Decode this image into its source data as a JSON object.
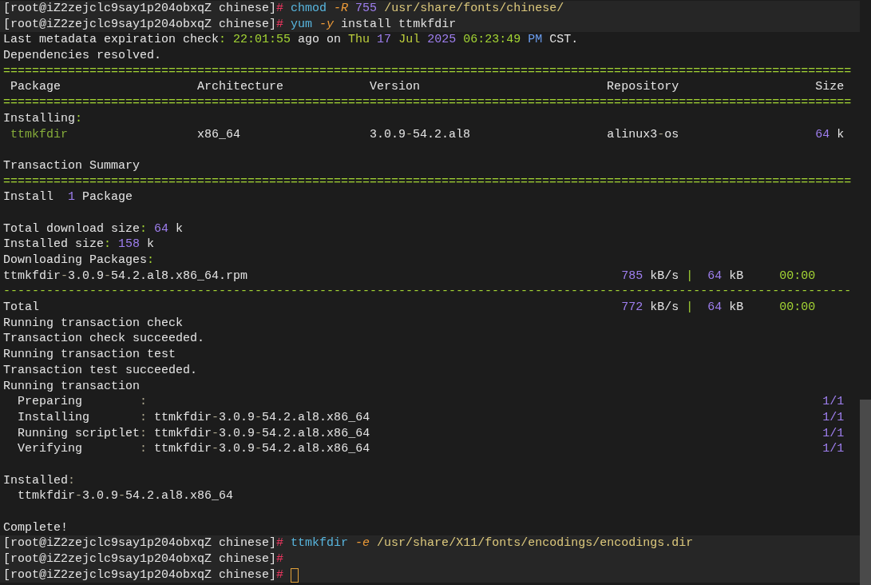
{
  "terminal": {
    "lines": [
      {
        "kind": "prompt",
        "segments": [
          {
            "text": "[root@iZ2zejclc9say1p204obxqZ chinese]",
            "kind": "text"
          },
          {
            "text": "#",
            "kind": "prompt_sign"
          },
          {
            "text": " chmod",
            "kind": "command"
          },
          {
            "text": " -R",
            "kind": "flag"
          },
          {
            "text": " 755",
            "kind": "number"
          },
          {
            "text": " /usr/share/fonts/chinese/",
            "kind": "path"
          }
        ]
      },
      {
        "kind": "prompt",
        "segments": [
          {
            "text": "[root@iZ2zejclc9say1p204obxqZ chinese]",
            "kind": "text"
          },
          {
            "text": "#",
            "kind": "prompt_sign"
          },
          {
            "text": " yum",
            "kind": "command"
          },
          {
            "text": " -y",
            "kind": "flag"
          },
          {
            "text": " install ttmkfdir",
            "kind": "text"
          }
        ]
      },
      {
        "kind": "output",
        "segments": [
          {
            "text": "Last metadata expiration check",
            "kind": "text"
          },
          {
            "text": ":",
            "kind": "accent"
          },
          {
            "text": " 22:01:55",
            "kind": "accent"
          },
          {
            "text": " ago on",
            "kind": "text"
          },
          {
            "text": " Thu",
            "kind": "date"
          },
          {
            "text": " 17",
            "kind": "number"
          },
          {
            "text": " Jul",
            "kind": "date"
          },
          {
            "text": " 2025",
            "kind": "number"
          },
          {
            "text": " 06:23:49",
            "kind": "accent"
          },
          {
            "text": " PM",
            "kind": "meridiem"
          },
          {
            "text": " CST.",
            "kind": "text"
          }
        ]
      },
      {
        "kind": "output",
        "segments": [
          {
            "text": "Dependencies resolved.",
            "kind": "text"
          }
        ]
      },
      {
        "kind": "separator",
        "segments": [
          {
            "text": "======================================================================================================================",
            "kind": "accent"
          }
        ]
      },
      {
        "kind": "header",
        "segments": [
          {
            "text": " Package                   Architecture            Version                          Repository                   Size",
            "kind": "text"
          }
        ]
      },
      {
        "kind": "separator",
        "segments": [
          {
            "text": "======================================================================================================================",
            "kind": "accent"
          }
        ]
      },
      {
        "kind": "output",
        "segments": [
          {
            "text": "Installing",
            "kind": "text"
          },
          {
            "text": ":",
            "kind": "accent"
          }
        ]
      },
      {
        "kind": "output",
        "segments": [
          {
            "text": " ttmkfdir",
            "kind": "package"
          },
          {
            "text": "                  x86_64                  3.0.9",
            "kind": "text"
          },
          {
            "text": "-",
            "kind": "punct"
          },
          {
            "text": "54.2.al8                   alinux3",
            "kind": "text"
          },
          {
            "text": "-",
            "kind": "punct"
          },
          {
            "text": "os                   ",
            "kind": "text"
          },
          {
            "text": "64",
            "kind": "number"
          },
          {
            "text": " k",
            "kind": "text"
          }
        ]
      },
      {
        "kind": "blank"
      },
      {
        "kind": "output",
        "segments": [
          {
            "text": "Transaction Summary",
            "kind": "text"
          }
        ]
      },
      {
        "kind": "separator",
        "segments": [
          {
            "text": "======================================================================================================================",
            "kind": "accent"
          }
        ]
      },
      {
        "kind": "output",
        "segments": [
          {
            "text": "Install  ",
            "kind": "text"
          },
          {
            "text": "1",
            "kind": "number"
          },
          {
            "text": " Package",
            "kind": "text"
          }
        ]
      },
      {
        "kind": "blank"
      },
      {
        "kind": "output",
        "segments": [
          {
            "text": "Total download size",
            "kind": "text"
          },
          {
            "text": ":",
            "kind": "accent"
          },
          {
            "text": " 64",
            "kind": "number"
          },
          {
            "text": " k",
            "kind": "text"
          }
        ]
      },
      {
        "kind": "output",
        "segments": [
          {
            "text": "Installed size",
            "kind": "text"
          },
          {
            "text": ":",
            "kind": "accent"
          },
          {
            "text": " 158",
            "kind": "number"
          },
          {
            "text": " k",
            "kind": "text"
          }
        ]
      },
      {
        "kind": "output",
        "segments": [
          {
            "text": "Downloading Packages",
            "kind": "text"
          },
          {
            "text": ":",
            "kind": "accent"
          }
        ]
      },
      {
        "kind": "output",
        "segments": [
          {
            "text": "ttmkfdir",
            "kind": "text"
          },
          {
            "text": "-",
            "kind": "punct"
          },
          {
            "text": "3.0.9",
            "kind": "text"
          },
          {
            "text": "-",
            "kind": "punct"
          },
          {
            "text": "54.2.al8.x86_64.rpm                                                    ",
            "kind": "text"
          },
          {
            "text": "785",
            "kind": "number"
          },
          {
            "text": " kB/s ",
            "kind": "text"
          },
          {
            "text": "|",
            "kind": "accent"
          },
          {
            "text": "  64",
            "kind": "number"
          },
          {
            "text": " kB",
            "kind": "text"
          },
          {
            "text": "     00:00",
            "kind": "accent"
          }
        ]
      },
      {
        "kind": "separator",
        "segments": [
          {
            "text": "----------------------------------------------------------------------------------------------------------------------",
            "kind": "accent"
          }
        ]
      },
      {
        "kind": "output",
        "segments": [
          {
            "text": "Total                                                                                 ",
            "kind": "text"
          },
          {
            "text": "772",
            "kind": "number"
          },
          {
            "text": " kB/s ",
            "kind": "text"
          },
          {
            "text": "|",
            "kind": "accent"
          },
          {
            "text": "  64",
            "kind": "number"
          },
          {
            "text": " kB",
            "kind": "text"
          },
          {
            "text": "     00:00",
            "kind": "accent"
          }
        ]
      },
      {
        "kind": "output",
        "segments": [
          {
            "text": "Running transaction check",
            "kind": "text"
          }
        ]
      },
      {
        "kind": "output",
        "segments": [
          {
            "text": "Transaction check succeeded.",
            "kind": "text"
          }
        ]
      },
      {
        "kind": "output",
        "segments": [
          {
            "text": "Running transaction test",
            "kind": "text"
          }
        ]
      },
      {
        "kind": "output",
        "segments": [
          {
            "text": "Transaction test succeeded.",
            "kind": "text"
          }
        ]
      },
      {
        "kind": "output",
        "segments": [
          {
            "text": "Running transaction",
            "kind": "text"
          }
        ]
      },
      {
        "kind": "output",
        "segments": [
          {
            "text": "  Preparing        ",
            "kind": "text"
          },
          {
            "text": ":",
            "kind": "punct"
          },
          {
            "text": "                                                                                              1/1",
            "kind": "number"
          }
        ]
      },
      {
        "kind": "output",
        "segments": [
          {
            "text": "  Installing       ",
            "kind": "text"
          },
          {
            "text": ":",
            "kind": "punct"
          },
          {
            "text": " ttmkfdir",
            "kind": "text"
          },
          {
            "text": "-",
            "kind": "punct"
          },
          {
            "text": "3.0.9",
            "kind": "text"
          },
          {
            "text": "-",
            "kind": "punct"
          },
          {
            "text": "54.2.al8.x86_64",
            "kind": "text"
          },
          {
            "text": "                                                               1/1",
            "kind": "number"
          }
        ]
      },
      {
        "kind": "output",
        "segments": [
          {
            "text": "  Running scriptlet",
            "kind": "text"
          },
          {
            "text": ":",
            "kind": "punct"
          },
          {
            "text": " ttmkfdir",
            "kind": "text"
          },
          {
            "text": "-",
            "kind": "punct"
          },
          {
            "text": "3.0.9",
            "kind": "text"
          },
          {
            "text": "-",
            "kind": "punct"
          },
          {
            "text": "54.2.al8.x86_64",
            "kind": "text"
          },
          {
            "text": "                                                               1/1",
            "kind": "number"
          }
        ]
      },
      {
        "kind": "output",
        "segments": [
          {
            "text": "  Verifying        ",
            "kind": "text"
          },
          {
            "text": ":",
            "kind": "punct"
          },
          {
            "text": " ttmkfdir",
            "kind": "text"
          },
          {
            "text": "-",
            "kind": "punct"
          },
          {
            "text": "3.0.9",
            "kind": "text"
          },
          {
            "text": "-",
            "kind": "punct"
          },
          {
            "text": "54.2.al8.x86_64",
            "kind": "text"
          },
          {
            "text": "                                                               1/1",
            "kind": "number"
          }
        ]
      },
      {
        "kind": "blank"
      },
      {
        "kind": "output",
        "segments": [
          {
            "text": "Installed",
            "kind": "text"
          },
          {
            "text": ":",
            "kind": "punct"
          }
        ]
      },
      {
        "kind": "output",
        "segments": [
          {
            "text": "  ttmkfdir",
            "kind": "text"
          },
          {
            "text": "-",
            "kind": "punct"
          },
          {
            "text": "3.0.9",
            "kind": "text"
          },
          {
            "text": "-",
            "kind": "punct"
          },
          {
            "text": "54.2.al8.x86_64",
            "kind": "text"
          }
        ]
      },
      {
        "kind": "blank"
      },
      {
        "kind": "output",
        "segments": [
          {
            "text": "Complete!",
            "kind": "text"
          }
        ]
      },
      {
        "kind": "prompt",
        "segments": [
          {
            "text": "[root@iZ2zejclc9say1p204obxqZ chinese]",
            "kind": "text"
          },
          {
            "text": "#",
            "kind": "prompt_sign"
          },
          {
            "text": " ttmkfdir",
            "kind": "command"
          },
          {
            "text": " -e",
            "kind": "flag"
          },
          {
            "text": " /usr/share/X11/fonts/encodings/encodings.dir",
            "kind": "path"
          }
        ]
      },
      {
        "kind": "prompt",
        "segments": [
          {
            "text": "[root@iZ2zejclc9say1p204obxqZ chinese]",
            "kind": "text"
          },
          {
            "text": "#",
            "kind": "prompt_sign"
          }
        ]
      },
      {
        "kind": "prompt",
        "cursor": true,
        "segments": [
          {
            "text": "[root@iZ2zejclc9say1p204obxqZ chinese]",
            "kind": "text"
          },
          {
            "text": "#",
            "kind": "prompt_sign"
          }
        ]
      }
    ]
  }
}
